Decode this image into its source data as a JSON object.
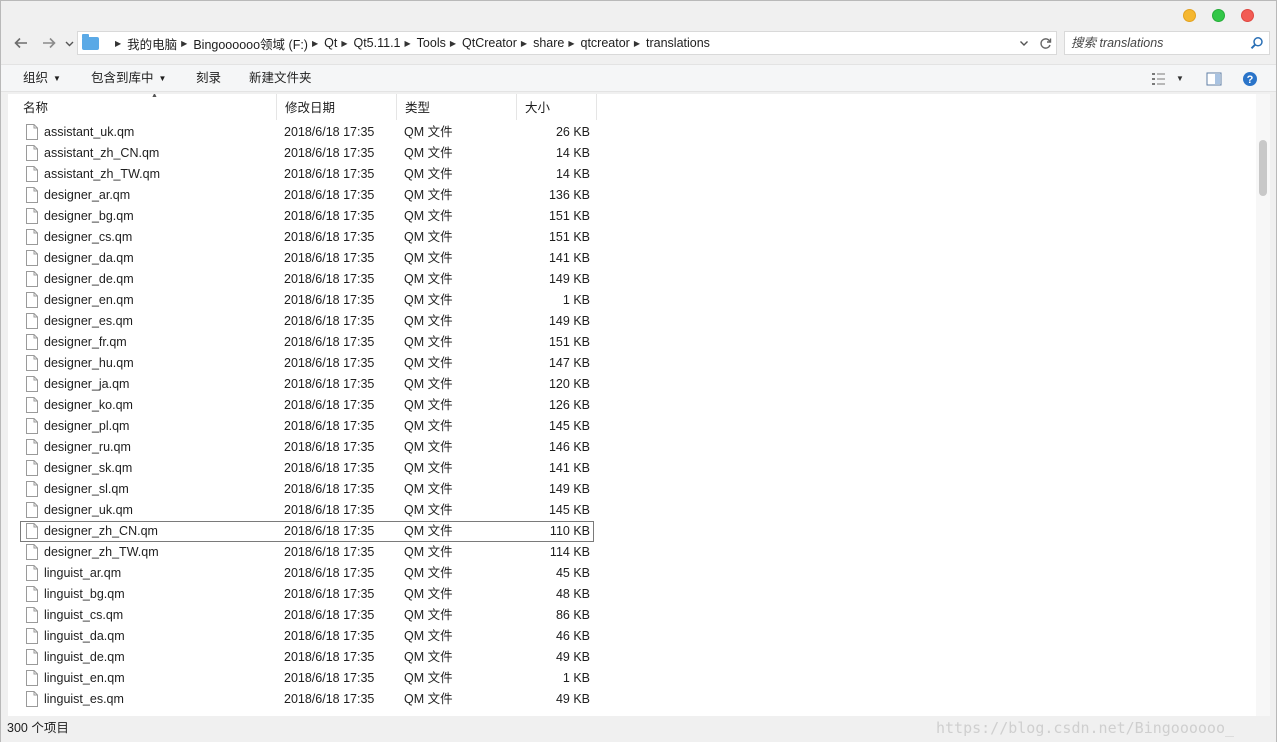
{
  "window": {
    "controls": {
      "minimize": "#f5b730",
      "maximize": "#33c748",
      "close": "#f25c54"
    }
  },
  "address": {
    "breadcrumbs": [
      "我的电脑",
      "Bingoooooo领域 (F:)",
      "Qt",
      "Qt5.11.1",
      "Tools",
      "QtCreator",
      "share",
      "qtcreator",
      "translations"
    ],
    "icons": {
      "back": "arrow-left-icon",
      "forward": "arrow-right-icon",
      "history": "chevron-down-icon",
      "refresh": "refresh-icon"
    }
  },
  "search": {
    "placeholder": "搜索 translations"
  },
  "toolbar": {
    "organize": "组织",
    "include_in_library": "包含到库中",
    "burn": "刻录",
    "new_folder": "新建文件夹"
  },
  "columns": {
    "name": "名称",
    "date": "修改日期",
    "type": "类型",
    "size": "大小"
  },
  "files": [
    {
      "name": "assistant_uk.qm",
      "date": "2018/6/18 17:35",
      "type": "QM 文件",
      "size": "26 KB"
    },
    {
      "name": "assistant_zh_CN.qm",
      "date": "2018/6/18 17:35",
      "type": "QM 文件",
      "size": "14 KB"
    },
    {
      "name": "assistant_zh_TW.qm",
      "date": "2018/6/18 17:35",
      "type": "QM 文件",
      "size": "14 KB"
    },
    {
      "name": "designer_ar.qm",
      "date": "2018/6/18 17:35",
      "type": "QM 文件",
      "size": "136 KB"
    },
    {
      "name": "designer_bg.qm",
      "date": "2018/6/18 17:35",
      "type": "QM 文件",
      "size": "151 KB"
    },
    {
      "name": "designer_cs.qm",
      "date": "2018/6/18 17:35",
      "type": "QM 文件",
      "size": "151 KB"
    },
    {
      "name": "designer_da.qm",
      "date": "2018/6/18 17:35",
      "type": "QM 文件",
      "size": "141 KB"
    },
    {
      "name": "designer_de.qm",
      "date": "2018/6/18 17:35",
      "type": "QM 文件",
      "size": "149 KB"
    },
    {
      "name": "designer_en.qm",
      "date": "2018/6/18 17:35",
      "type": "QM 文件",
      "size": "1 KB"
    },
    {
      "name": "designer_es.qm",
      "date": "2018/6/18 17:35",
      "type": "QM 文件",
      "size": "149 KB"
    },
    {
      "name": "designer_fr.qm",
      "date": "2018/6/18 17:35",
      "type": "QM 文件",
      "size": "151 KB"
    },
    {
      "name": "designer_hu.qm",
      "date": "2018/6/18 17:35",
      "type": "QM 文件",
      "size": "147 KB"
    },
    {
      "name": "designer_ja.qm",
      "date": "2018/6/18 17:35",
      "type": "QM 文件",
      "size": "120 KB"
    },
    {
      "name": "designer_ko.qm",
      "date": "2018/6/18 17:35",
      "type": "QM 文件",
      "size": "126 KB"
    },
    {
      "name": "designer_pl.qm",
      "date": "2018/6/18 17:35",
      "type": "QM 文件",
      "size": "145 KB"
    },
    {
      "name": "designer_ru.qm",
      "date": "2018/6/18 17:35",
      "type": "QM 文件",
      "size": "146 KB"
    },
    {
      "name": "designer_sk.qm",
      "date": "2018/6/18 17:35",
      "type": "QM 文件",
      "size": "141 KB"
    },
    {
      "name": "designer_sl.qm",
      "date": "2018/6/18 17:35",
      "type": "QM 文件",
      "size": "149 KB"
    },
    {
      "name": "designer_uk.qm",
      "date": "2018/6/18 17:35",
      "type": "QM 文件",
      "size": "145 KB"
    },
    {
      "name": "designer_zh_CN.qm",
      "date": "2018/6/18 17:35",
      "type": "QM 文件",
      "size": "110 KB",
      "selected": true
    },
    {
      "name": "designer_zh_TW.qm",
      "date": "2018/6/18 17:35",
      "type": "QM 文件",
      "size": "114 KB"
    },
    {
      "name": "linguist_ar.qm",
      "date": "2018/6/18 17:35",
      "type": "QM 文件",
      "size": "45 KB"
    },
    {
      "name": "linguist_bg.qm",
      "date": "2018/6/18 17:35",
      "type": "QM 文件",
      "size": "48 KB"
    },
    {
      "name": "linguist_cs.qm",
      "date": "2018/6/18 17:35",
      "type": "QM 文件",
      "size": "86 KB"
    },
    {
      "name": "linguist_da.qm",
      "date": "2018/6/18 17:35",
      "type": "QM 文件",
      "size": "46 KB"
    },
    {
      "name": "linguist_de.qm",
      "date": "2018/6/18 17:35",
      "type": "QM 文件",
      "size": "49 KB"
    },
    {
      "name": "linguist_en.qm",
      "date": "2018/6/18 17:35",
      "type": "QM 文件",
      "size": "1 KB"
    },
    {
      "name": "linguist_es.qm",
      "date": "2018/6/18 17:35",
      "type": "QM 文件",
      "size": "49 KB"
    }
  ],
  "status": {
    "item_count": "300 个项目",
    "watermark": "https://blog.csdn.net/Bingoooooo_"
  }
}
